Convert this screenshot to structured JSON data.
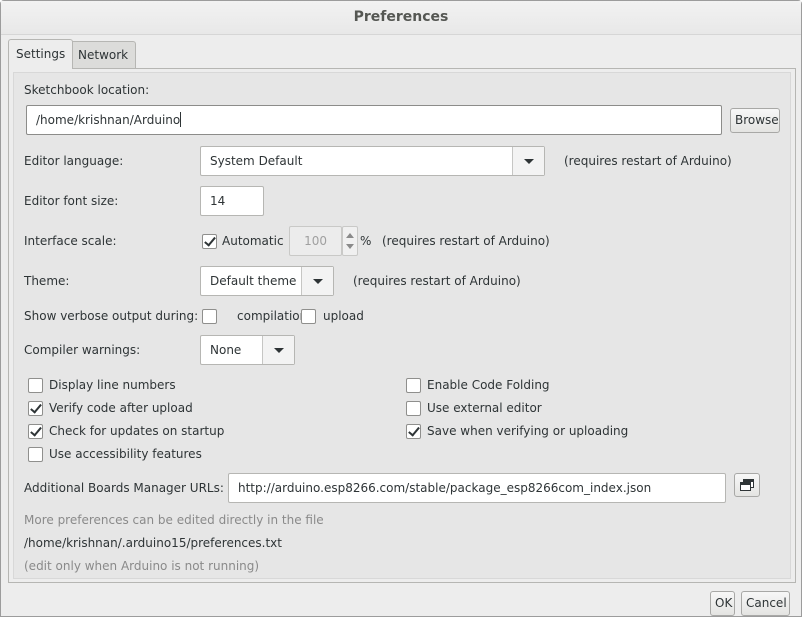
{
  "window": {
    "title": "Preferences"
  },
  "tabs": [
    {
      "label": "Settings",
      "active": true
    },
    {
      "label": "Network",
      "active": false
    }
  ],
  "settings": {
    "sketchbook_label": "Sketchbook location:",
    "sketchbook_path": "/home/krishnan/Arduino",
    "browse_label": "Browse",
    "language_label": "Editor language:",
    "language_value": "System Default",
    "language_note": "(requires restart of Arduino)",
    "font_size_label": "Editor font size:",
    "font_size_value": "14",
    "scale_label": "Interface scale:",
    "scale_auto_label": "Automatic",
    "scale_auto_checked": true,
    "scale_value": "100",
    "scale_unit": "%",
    "scale_note": "(requires restart of Arduino)",
    "theme_label": "Theme:",
    "theme_value": "Default theme",
    "theme_note": "(requires restart of Arduino)",
    "verbose_label": "Show verbose output during:",
    "verbose_compilation_label": "compilation",
    "verbose_compilation_checked": false,
    "verbose_upload_label": "upload",
    "verbose_upload_checked": false,
    "warnings_label": "Compiler warnings:",
    "warnings_value": "None",
    "options_left": [
      {
        "label": "Display line numbers",
        "checked": false
      },
      {
        "label": "Verify code after upload",
        "checked": true
      },
      {
        "label": "Check for updates on startup",
        "checked": true
      },
      {
        "label": "Use accessibility features",
        "checked": false
      }
    ],
    "options_right": [
      {
        "label": "Enable Code Folding",
        "checked": false
      },
      {
        "label": "Use external editor",
        "checked": false
      },
      {
        "label": "Save when verifying or uploading",
        "checked": true
      }
    ],
    "boards_url_label": "Additional Boards Manager URLs:",
    "boards_url_value": "http://arduino.esp8266.com/stable/package_esp8266com_index.json",
    "more_prefs_note": "More preferences can be edited directly in the file",
    "prefs_file_path": "/home/krishnan/.arduino15/preferences.txt",
    "edit_note": "(edit only when Arduino is not running)"
  },
  "footer": {
    "ok_label": "OK",
    "cancel_label": "Cancel"
  },
  "icons": {
    "combo_arrow": "chevron-down-icon",
    "checkbox_check": "checkmark-icon",
    "url_editor": "window-stack-icon",
    "spin_up": "chevron-up-icon",
    "spin_down": "chevron-down-icon"
  }
}
